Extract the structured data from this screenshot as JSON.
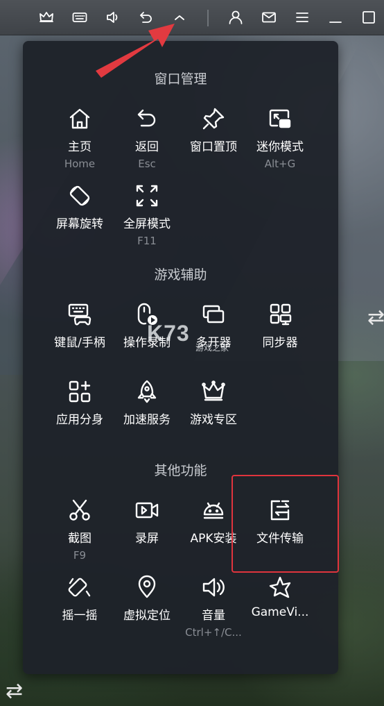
{
  "toolbar": {
    "buttons": [
      {
        "name": "crown-icon"
      },
      {
        "name": "keyboard-icon"
      },
      {
        "name": "volume-icon"
      },
      {
        "name": "back-icon"
      },
      {
        "name": "chevron-up-icon"
      },
      {
        "name": "user-icon"
      },
      {
        "name": "mail-icon"
      },
      {
        "name": "menu-icon"
      },
      {
        "name": "minimize-icon"
      },
      {
        "name": "maximize-icon"
      }
    ]
  },
  "panel": {
    "sections": [
      {
        "title": "窗口管理"
      },
      {
        "title": "游戏辅助"
      },
      {
        "title": "其他功能"
      }
    ],
    "items": {
      "home": {
        "label": "主页",
        "shortcut": "Home",
        "icon": "home-icon"
      },
      "back": {
        "label": "返回",
        "shortcut": "Esc",
        "icon": "back-icon"
      },
      "pin": {
        "label": "窗口置顶",
        "icon": "pin-icon"
      },
      "mini": {
        "label": "迷你模式",
        "shortcut": "Alt+G",
        "icon": "mini-mode-icon"
      },
      "rotate": {
        "label": "屏幕旋转",
        "icon": "rotate-icon"
      },
      "fullscreen": {
        "label": "全屏模式",
        "shortcut": "F11",
        "icon": "fullscreen-icon"
      },
      "keymouse": {
        "label": "键鼠/手柄",
        "icon": "gamepad-icon"
      },
      "record": {
        "label": "操作录制",
        "icon": "record-macro-icon"
      },
      "multi": {
        "label": "多开器",
        "icon": "multi-instance-icon"
      },
      "sync": {
        "label": "同步器",
        "icon": "sync-icon"
      },
      "clone": {
        "label": "应用分身",
        "icon": "apps-icon"
      },
      "boost": {
        "label": "加速服务",
        "icon": "rocket-icon"
      },
      "gamezone": {
        "label": "游戏专区",
        "icon": "crown-icon"
      },
      "screenshot": {
        "label": "截图",
        "shortcut": "F9",
        "icon": "scissors-icon"
      },
      "screenrec": {
        "label": "录屏",
        "icon": "video-icon"
      },
      "apk": {
        "label": "APK安装",
        "icon": "android-icon"
      },
      "filetransfer": {
        "label": "文件传输",
        "icon": "file-transfer-icon"
      },
      "shake": {
        "label": "摇一摇",
        "icon": "shake-icon"
      },
      "location": {
        "label": "虚拟定位",
        "icon": "location-icon"
      },
      "volume": {
        "label": "音量",
        "shortcut": "Ctrl+↑/C...",
        "icon": "volume-icon"
      },
      "gameview": {
        "label": "GameVi...",
        "icon": "gameview-icon"
      }
    }
  },
  "watermark": {
    "big": "K73",
    "small": "游戏之家"
  },
  "colors": {
    "highlight": "#e0343d",
    "arrow": "#e23a40",
    "panel": "#1e2229"
  }
}
